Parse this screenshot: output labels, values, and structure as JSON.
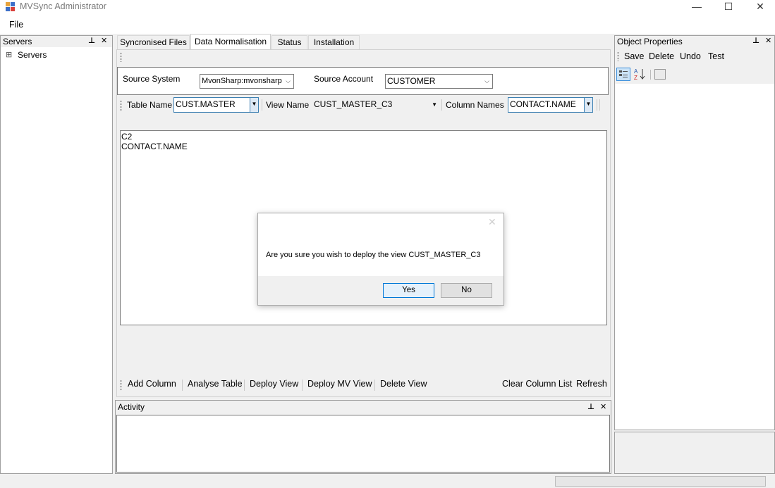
{
  "window": {
    "title": "MVSync Administrator",
    "minimize": "—",
    "maximize": "☐",
    "close": "✕"
  },
  "menu": {
    "file": "File"
  },
  "servers_panel": {
    "title": "Servers",
    "pin": "⊥",
    "close": "✕",
    "tree_root": "Servers",
    "expander": "⊞"
  },
  "tabs": [
    "Syncronised Files",
    "Data Normalisation",
    "Status",
    "Installation"
  ],
  "source": {
    "system_label": "Source System",
    "system_value": "MvonSharp:mvonsharp",
    "account_label": "Source Account",
    "account_value": "CUSTOMER"
  },
  "view_bar": {
    "table_label": "Table Name",
    "table_value": "CUST.MASTER",
    "view_label": "View Name",
    "view_value": "CUST_MASTER_C3",
    "column_label": "Column Names",
    "column_value": "CONTACT.NAME"
  },
  "editor": {
    "lines": [
      "C2",
      "CONTACT.NAME"
    ]
  },
  "bottom_toolbar": {
    "add_column": "Add Column",
    "analyse_table": "Analyse Table",
    "deploy_view": "Deploy View",
    "deploy_mv_view": "Deploy MV View",
    "delete_view": "Delete View",
    "clear_column_list": "Clear Column List",
    "refresh": "Refresh"
  },
  "activity_panel": {
    "title": "Activity",
    "pin": "⊥",
    "close": "✕"
  },
  "object_properties": {
    "title": "Object Properties",
    "pin": "⊥",
    "close": "✕",
    "save": "Save",
    "delete": "Delete",
    "undo": "Undo",
    "test": "Test"
  },
  "dialog": {
    "message": "Are you sure you wish to deploy the view CUST_MASTER_C3",
    "yes": "Yes",
    "no": "No",
    "close": "✕"
  }
}
